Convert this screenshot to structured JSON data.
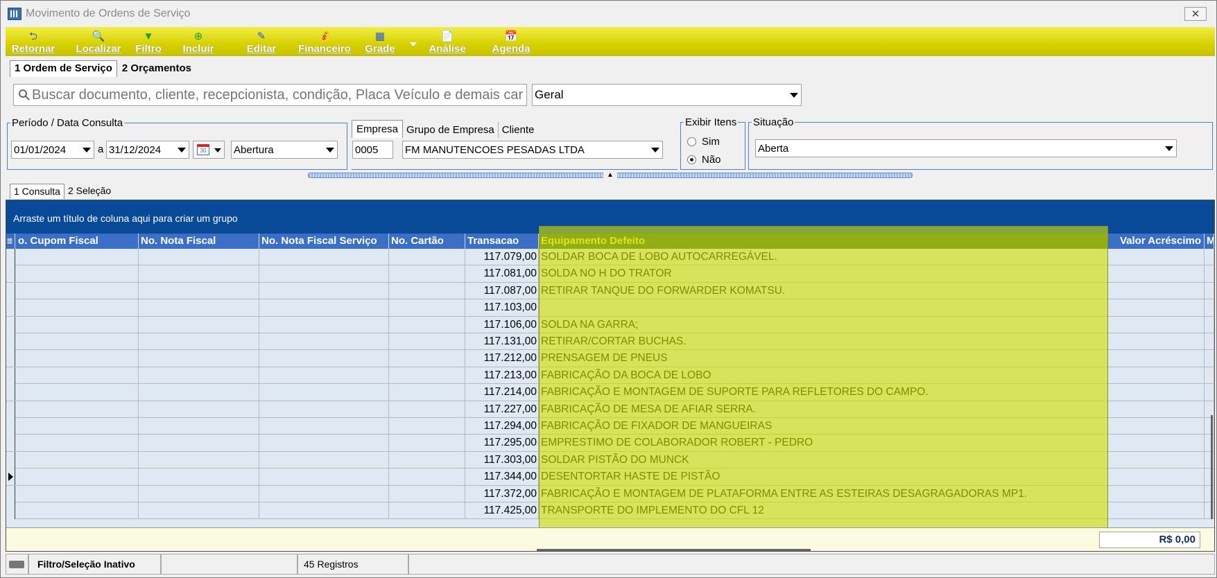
{
  "window": {
    "title": "Movimento de Ordens de Serviço",
    "close_label": "✕"
  },
  "toolbar": [
    {
      "label": "Retornar",
      "icon": "return-icon",
      "glyph": "⮌",
      "color": "#2a5bd7"
    },
    {
      "label": "Localizar",
      "icon": "search-icon",
      "glyph": "🔍",
      "color": "#2a5bd7"
    },
    {
      "label": "Filtro",
      "icon": "filter-icon",
      "glyph": "▼",
      "color": "#1a9f2a"
    },
    {
      "label": "Incluir",
      "icon": "add-icon",
      "glyph": "⊕",
      "color": "#1a9f2a"
    },
    {
      "label": "Editar",
      "icon": "edit-icon",
      "glyph": "✎",
      "color": "#2a5bd7"
    },
    {
      "label": "Financeiro",
      "icon": "money-icon",
      "glyph": "💰",
      "color": "#1a9f2a"
    },
    {
      "label": "Grade",
      "icon": "grid-icon",
      "glyph": "▦",
      "color": "#2a5bd7"
    },
    {
      "label": "Análise",
      "icon": "document-icon",
      "glyph": "📄",
      "color": "#2a5bd7"
    },
    {
      "label": "Agenda",
      "icon": "calendar-icon",
      "glyph": "📅",
      "color": "#d22"
    }
  ],
  "main_tabs": [
    "1 Ordem de Serviço",
    "2 Orçamentos"
  ],
  "search": {
    "placeholder": "Buscar documento, cliente, recepcionista, condição, Placa Veículo e demais car",
    "scope": "Geral"
  },
  "periodo": {
    "legend": "Período / Data Consulta",
    "from": "01/01/2024",
    "sep": "a",
    "to": "31/12/2024",
    "type": "Abertura"
  },
  "empresa_tabs": [
    "Empresa",
    "Grupo de Empresa",
    "Cliente"
  ],
  "empresa": {
    "code": "0005",
    "name": "FM MANUTENCOES PESADAS LTDA"
  },
  "exibir_itens": {
    "legend": "Exibir Itens",
    "options": [
      "Sim",
      "Não"
    ],
    "selected": "Não"
  },
  "situacao": {
    "legend": "Situação",
    "value": "Aberta"
  },
  "grid_tabs": [
    "1 Consulta",
    "2 Seleção"
  ],
  "grid": {
    "group_hint": "Arraste um título de coluna aqui para criar um grupo",
    "columns": [
      "o. Cupom Fiscal",
      "No. Nota Fiscal",
      "No. Nota Fiscal Serviço",
      "No. Cartão",
      "Transacao",
      "Equipamento Defeito",
      "Valor Acréscimo",
      "M"
    ],
    "rows": [
      {
        "transacao": "117.079,00",
        "defeito": "SOLDAR BOCA DE LOBO AUTOCARREGÁVEL."
      },
      {
        "transacao": "117.081,00",
        "defeito": "SOLDA NO H DO TRATOR"
      },
      {
        "transacao": "117.087,00",
        "defeito": "RETIRAR TANQUE DO FORWARDER KOMATSU."
      },
      {
        "transacao": "117.103,00",
        "defeito": ""
      },
      {
        "transacao": "117.106,00",
        "defeito": "SOLDA NA GARRA;"
      },
      {
        "transacao": "117.131,00",
        "defeito": "RETIRAR/CORTAR BUCHAS."
      },
      {
        "transacao": "117.212,00",
        "defeito": "PRENSAGEM DE PNEUS"
      },
      {
        "transacao": "117.213,00",
        "defeito": "FABRICAÇÃO DA BOCA DE LOBO"
      },
      {
        "transacao": "117.214,00",
        "defeito": "FABRICAÇÃO E MONTAGEM DE SUPORTE PARA REFLETORES DO CAMPO."
      },
      {
        "transacao": "117.227,00",
        "defeito": "FABRICAÇÃO DE MESA DE AFIAR SERRA."
      },
      {
        "transacao": "117.294,00",
        "defeito": "FABRICAÇÃO DE FIXADOR DE MANGUEIRAS"
      },
      {
        "transacao": "117.295,00",
        "defeito": "EMPRESTIMO DE COLABORADOR ROBERT - PEDRO"
      },
      {
        "transacao": "117.303,00",
        "defeito": "SOLDAR PISTÃO DO MUNCK"
      },
      {
        "transacao": "117.344,00",
        "defeito": "DESENTORTAR HASTE DE PISTÃO"
      },
      {
        "transacao": "117.372,00",
        "defeito": "FABRICAÇÃO E MONTAGEM DE PLATAFORMA ENTRE AS ESTEIRAS DESAGRAGADORAS MP1."
      },
      {
        "transacao": "117.425,00",
        "defeito": "TRANSPORTE DO IMPLEMENTO DO CFL 12"
      }
    ],
    "current_row": 13,
    "total": "R$ 0,00"
  },
  "status": {
    "filter": "Filtro/Seleção Inativo",
    "empty": "",
    "records": "45 Registros"
  }
}
